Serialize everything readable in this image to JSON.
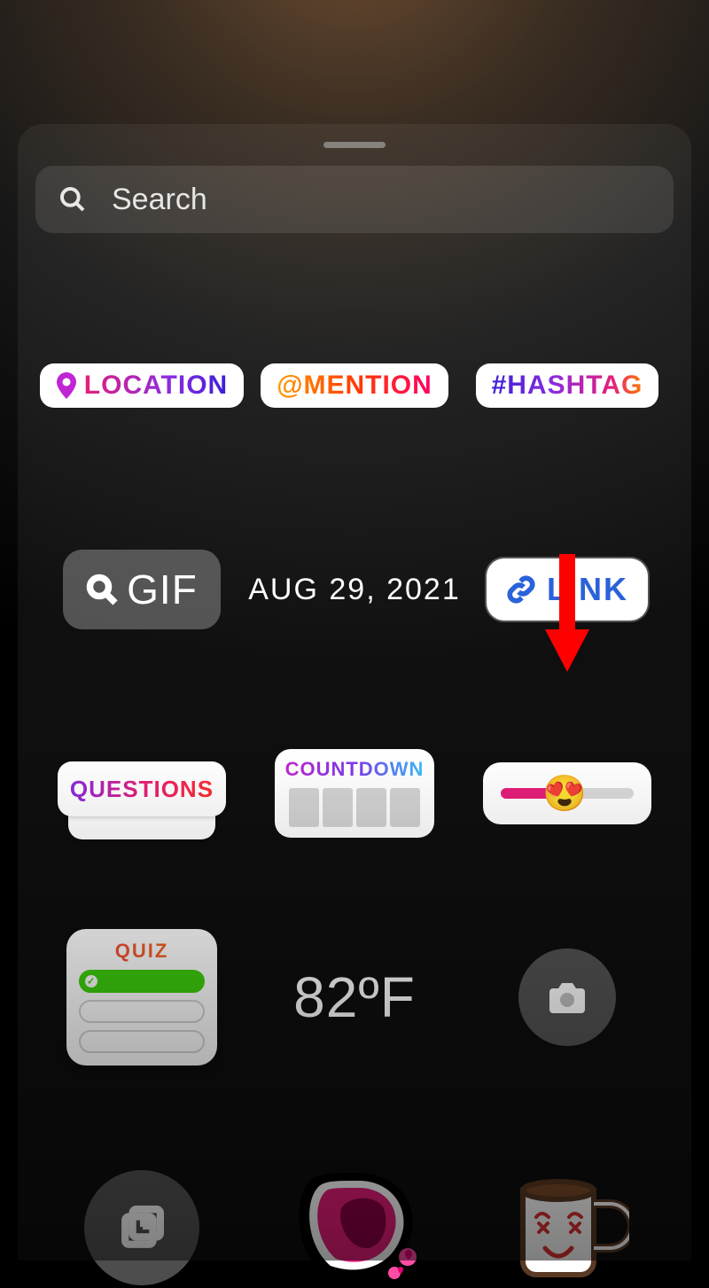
{
  "search": {
    "placeholder": "Search"
  },
  "stickers": {
    "location": "LOCATION",
    "mention": "@MENTION",
    "hashtag": "#HASHTAG",
    "gif": "GIF",
    "date": "AUG 29, 2021",
    "link": "LINK",
    "questions": "QUESTIONS",
    "countdown": "COUNTDOWN",
    "slider_emoji": "😍",
    "quiz": "QUIZ",
    "temperature": "82ºF"
  }
}
